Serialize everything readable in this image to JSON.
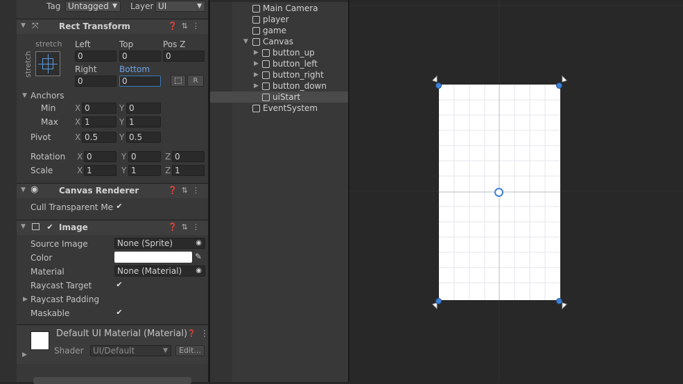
{
  "header": {
    "tag_label": "Tag",
    "tag_value": "Untagged",
    "layer_label": "Layer",
    "layer_value": "UI"
  },
  "rect_transform": {
    "title": "Rect Transform",
    "anchor_preset_h": "stretch",
    "anchor_preset_v": "stretch",
    "left_label": "Left",
    "left_value": "0",
    "top_label": "Top",
    "top_value": "0",
    "posz_label": "Pos Z",
    "posz_value": "0",
    "right_label": "Right",
    "right_value": "0",
    "bottom_label": "Bottom",
    "bottom_value": "0",
    "r_button": "R",
    "anchors_label": "Anchors",
    "min_label": "Min",
    "min_x": "0",
    "min_y": "0",
    "max_label": "Max",
    "max_x": "1",
    "max_y": "1",
    "pivot_label": "Pivot",
    "pivot_x": "0.5",
    "pivot_y": "0.5",
    "rotation_label": "Rotation",
    "rot_x": "0",
    "rot_y": "0",
    "rot_z": "0",
    "scale_label": "Scale",
    "scale_x": "1",
    "scale_y": "1",
    "scale_z": "1",
    "x": "X",
    "y": "Y",
    "z": "Z"
  },
  "canvas_renderer": {
    "title": "Canvas Renderer",
    "cull_label": "Cull Transparent Mes"
  },
  "image": {
    "title": "Image",
    "source_label": "Source Image",
    "source_value": "None (Sprite)",
    "color_label": "Color",
    "material_label": "Material",
    "material_value": "None (Material)",
    "raycast_label": "Raycast Target",
    "padding_label": "Raycast Padding",
    "maskable_label": "Maskable"
  },
  "material": {
    "title": "Default UI Material (Material)",
    "shader_label": "Shader",
    "shader_value": "UI/Default",
    "edit_label": "Edit..."
  },
  "hierarchy": {
    "items": [
      "Main Camera",
      "player",
      "game",
      "Canvas",
      "button_up",
      "button_left",
      "button_right",
      "button_down",
      "uiStart",
      "EventSystem"
    ]
  },
  "colors": {
    "accent": "#3d82d9",
    "panel": "#383838",
    "scene": "#282828"
  }
}
